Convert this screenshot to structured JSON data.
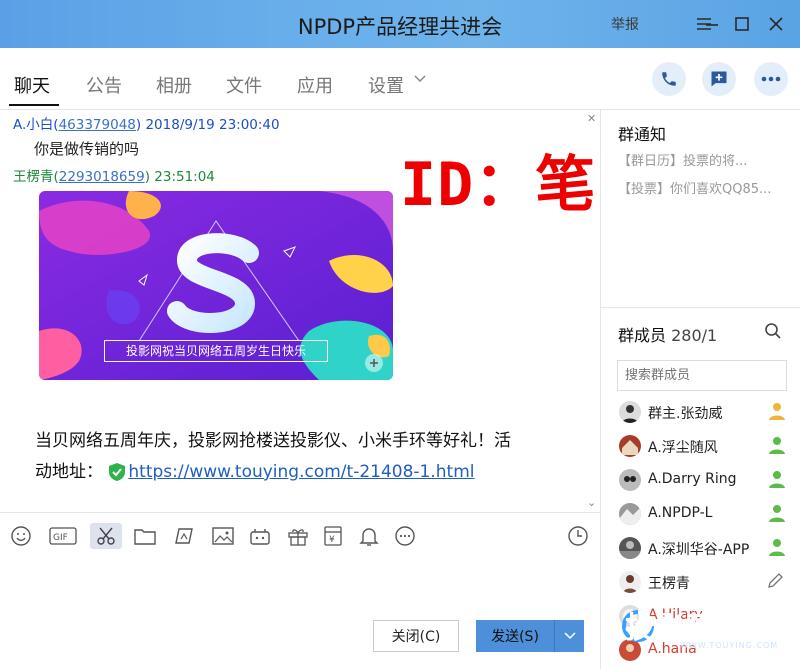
{
  "window": {
    "title": "NPDP产品经理共进会",
    "report": "举报"
  },
  "tabs": [
    {
      "label": "聊天"
    },
    {
      "label": "公告"
    },
    {
      "label": "相册"
    },
    {
      "label": "文件"
    },
    {
      "label": "应用"
    },
    {
      "label": "设置"
    }
  ],
  "chat": {
    "watermark_id": "ID：笔中求生",
    "messages": [
      {
        "name": "A.小白",
        "id": "463379048",
        "time": "2018/9/19 23:00:40",
        "text": "你是做传销的吗"
      },
      {
        "name": "王楞青",
        "id": "2293018659",
        "time": "23:51:04"
      }
    ],
    "banner_caption": "投影网祝当贝网络五周岁生日快乐",
    "promo_line1": "当贝网络五周年庆，投影网抢楼送投影仪、小米手环等好礼！活",
    "promo_line2_prefix": "动地址：",
    "promo_link": "https://www.touying.com/t-21408-1.html"
  },
  "toolbar": {
    "icons": [
      "smiley-icon",
      "gif-icon",
      "scissors-icon",
      "folder-icon",
      "screenshot-icon",
      "image-icon",
      "game-icon",
      "gift-icon",
      "redpacket-icon",
      "bell-icon",
      "more-icon"
    ]
  },
  "buttons": {
    "close": "关闭(C)",
    "send": "发送(S)"
  },
  "notice": {
    "title": "群通知",
    "line1": "【群日历】投票的将...",
    "line2": "【投票】你们喜欢QQ85..."
  },
  "members": {
    "title": "群成员",
    "count": "280/1",
    "search_placeholder": "搜索群成员",
    "list": [
      {
        "name": "群主.张劲威"
      },
      {
        "name": "A.浮尘随风"
      },
      {
        "name": "A.Darry Ring"
      },
      {
        "name": "A.NPDP-L"
      },
      {
        "name": "A.深圳华谷-APP"
      },
      {
        "name": "王楞青"
      },
      {
        "name": "A.Hilary"
      },
      {
        "name": "A.hana"
      }
    ]
  },
  "watermark_bottom": {
    "text": "投影网",
    "sub": "WWW.TOUYING.COM"
  },
  "colors": {
    "titlebar": "#68aeea",
    "accent_blue": "#4d8fd8",
    "name_blue": "#1a4fc9",
    "name_green": "#1a8a3a",
    "watermark_red": "#ee0000"
  }
}
